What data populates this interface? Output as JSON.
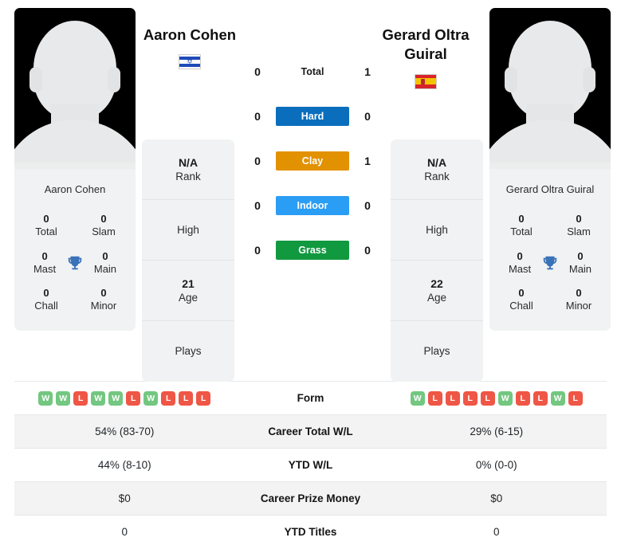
{
  "players": {
    "left": {
      "name": "Aaron Cohen",
      "name_lines": [
        "Aaron Cohen"
      ],
      "country": "Israel",
      "flag_icon": "flag-israel-icon",
      "avatar_alt": "player-silhouette",
      "card_name": "Aaron Cohen",
      "titles": [
        {
          "num": "0",
          "label": "Total"
        },
        {
          "num": "0",
          "label": "Slam"
        },
        {
          "num": "0",
          "label": "Mast"
        },
        {
          "num": "0",
          "label": "Main"
        },
        {
          "num": "0",
          "label": "Chall"
        },
        {
          "num": "0",
          "label": "Minor"
        }
      ],
      "info": [
        {
          "value": "N/A",
          "label": "Rank"
        },
        {
          "value": "",
          "label": "High"
        },
        {
          "value": "21",
          "label": "Age"
        },
        {
          "value": "",
          "label": "Plays"
        }
      ],
      "surface_scores": {
        "total": "0",
        "hard": "0",
        "clay": "0",
        "indoor": "0",
        "grass": "0"
      },
      "form": [
        "W",
        "W",
        "L",
        "W",
        "W",
        "L",
        "W",
        "L",
        "L",
        "L"
      ],
      "career_total_wl": "54% (83-70)",
      "ytd_wl": "44% (8-10)",
      "career_prize_money": "$0",
      "ytd_titles": "0"
    },
    "right": {
      "name": "Gerard Oltra Guiral",
      "name_lines": [
        "Gerard Oltra",
        "Guiral"
      ],
      "country": "Spain",
      "flag_icon": "flag-spain-icon",
      "avatar_alt": "player-silhouette",
      "card_name": "Gerard Oltra Guiral",
      "titles": [
        {
          "num": "0",
          "label": "Total"
        },
        {
          "num": "0",
          "label": "Slam"
        },
        {
          "num": "0",
          "label": "Mast"
        },
        {
          "num": "0",
          "label": "Main"
        },
        {
          "num": "0",
          "label": "Chall"
        },
        {
          "num": "0",
          "label": "Minor"
        }
      ],
      "info": [
        {
          "value": "N/A",
          "label": "Rank"
        },
        {
          "value": "",
          "label": "High"
        },
        {
          "value": "22",
          "label": "Age"
        },
        {
          "value": "",
          "label": "Plays"
        }
      ],
      "surface_scores": {
        "total": "1",
        "hard": "0",
        "clay": "1",
        "indoor": "0",
        "grass": "0"
      },
      "form": [
        "W",
        "L",
        "L",
        "L",
        "L",
        "W",
        "L",
        "L",
        "W",
        "L"
      ],
      "career_total_wl": "29% (6-15)",
      "ytd_wl": "0% (0-0)",
      "career_prize_money": "$0",
      "ytd_titles": "0"
    }
  },
  "surfaces": [
    {
      "key": "total",
      "label": "Total",
      "color": "",
      "plain": true
    },
    {
      "key": "hard",
      "label": "Hard",
      "color": "#0a6ebd",
      "plain": false
    },
    {
      "key": "clay",
      "label": "Clay",
      "color": "#e29100",
      "plain": false
    },
    {
      "key": "indoor",
      "label": "Indoor",
      "color": "#2a9df4",
      "plain": false
    },
    {
      "key": "grass",
      "label": "Grass",
      "color": "#11993f",
      "plain": false
    }
  ],
  "stats_table": {
    "rows": [
      {
        "label": "Form",
        "type": "form"
      },
      {
        "label": "Career Total W/L",
        "type": "text",
        "key": "career_total_wl"
      },
      {
        "label": "YTD W/L",
        "type": "text",
        "key": "ytd_wl"
      },
      {
        "label": "Career Prize Money",
        "type": "text",
        "key": "career_prize_money"
      },
      {
        "label": "YTD Titles",
        "type": "text",
        "key": "ytd_titles"
      }
    ]
  },
  "icons": {
    "trophy": "trophy-icon"
  },
  "colors": {
    "hard": "#0a6ebd",
    "clay": "#e29100",
    "indoor": "#2a9df4",
    "grass": "#11993f",
    "win": "#73c780",
    "loss": "#ef5645",
    "trophy": "#3a72b8",
    "panel": "#f1f2f3"
  }
}
